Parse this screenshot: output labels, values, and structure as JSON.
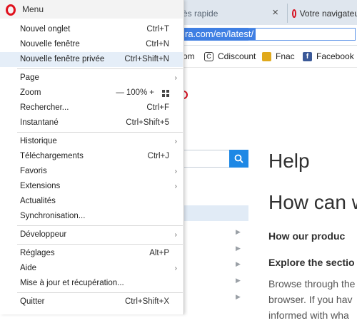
{
  "browser": {
    "tabs": [
      {
        "title": "ès rapide",
        "close": "×"
      },
      {
        "title": "Votre navigateur"
      }
    ],
    "url": "ra.com/en/latest/",
    "bookmarks": [
      {
        "label": "om",
        "icon": "none"
      },
      {
        "label": "Cdiscount",
        "icon": "cdiscount-icon"
      },
      {
        "label": "Fnac",
        "icon": "fnac-icon"
      },
      {
        "label": "Facebook",
        "icon": "facebook-icon"
      }
    ]
  },
  "help_page": {
    "title": "Help",
    "heading": "How can w",
    "subheading": "How our produc",
    "section": "Explore the sectio",
    "paragraph": [
      "Browse through the",
      "browser. If you hav",
      "informed with wha"
    ]
  },
  "menu": {
    "title": "Menu",
    "items": [
      {
        "label": "Nouvel onglet",
        "shortcut": "Ctrl+T"
      },
      {
        "label": "Nouvelle fenêtre",
        "shortcut": "Ctrl+N"
      },
      {
        "label": "Nouvelle fenêtre privée",
        "shortcut": "Ctrl+Shift+N"
      },
      {
        "label": "Page"
      },
      {
        "label": "Zoom",
        "zoom_minus": "—",
        "zoom_value": "100%",
        "zoom_plus": "+"
      },
      {
        "label": "Rechercher...",
        "shortcut": "Ctrl+F"
      },
      {
        "label": "Instantané",
        "shortcut": "Ctrl+Shift+5"
      },
      {
        "label": "Historique"
      },
      {
        "label": "Téléchargements",
        "shortcut": "Ctrl+J"
      },
      {
        "label": "Favoris"
      },
      {
        "label": "Extensions"
      },
      {
        "label": "Actualités"
      },
      {
        "label": "Synchronisation..."
      },
      {
        "label": "Développeur"
      },
      {
        "label": "Réglages",
        "shortcut": "Alt+P"
      },
      {
        "label": "Aide"
      },
      {
        "label": "Mise à jour et récupération..."
      },
      {
        "label": "Quitter",
        "shortcut": "Ctrl+Shift+X"
      }
    ],
    "colors": {
      "accent": "#e0121e",
      "hover": "#e5eef8"
    }
  }
}
